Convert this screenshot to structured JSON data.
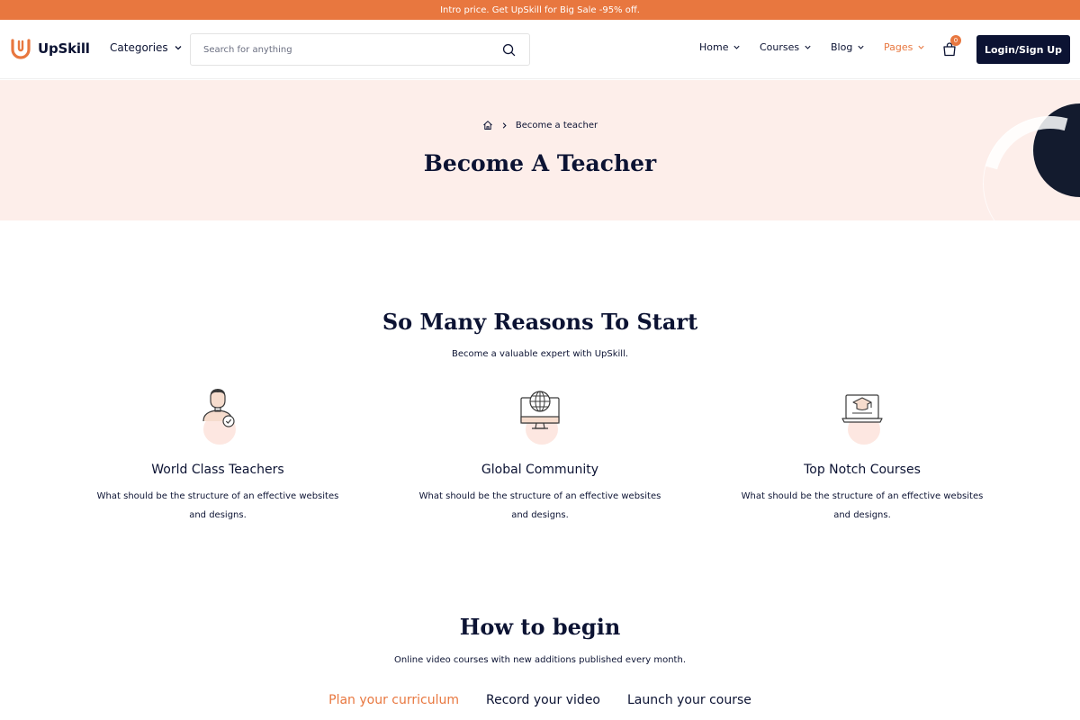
{
  "promo": {
    "text": "Intro price. Get UpSkill for Big Sale -95% off."
  },
  "header": {
    "logo_text": "UpSkill",
    "categories_label": "Categories",
    "search_placeholder": "Search for anything",
    "nav": [
      {
        "label": "Home",
        "active": false
      },
      {
        "label": "Courses",
        "active": false
      },
      {
        "label": "Blog",
        "active": false
      },
      {
        "label": "Pages",
        "active": true
      }
    ],
    "cart_count": "0",
    "login_label": "Login/Sign Up"
  },
  "colors": {
    "accent": "#e8773f",
    "dark": "#0c1333",
    "hero_bg": "#fdeeea"
  },
  "hero": {
    "breadcrumb_current": "Become a teacher",
    "title": "Become A Teacher"
  },
  "reasons": {
    "title": "So Many Reasons To Start",
    "subtitle": "Become a valuable expert with UpSkill.",
    "features": [
      {
        "icon": "teacher-icon",
        "title": "World Class Teachers",
        "desc_line1": "What should be the structure of an effective websites",
        "desc_line2": "and designs."
      },
      {
        "icon": "globe-monitor-icon",
        "title": "Global Community",
        "desc_line1": "What should be the structure of an effective websites",
        "desc_line2": "and designs."
      },
      {
        "icon": "laptop-graduation-icon",
        "title": "Top Notch Courses",
        "desc_line1": "What should be the structure of an effective websites",
        "desc_line2": "and designs."
      }
    ]
  },
  "how_to_begin": {
    "title": "How to begin",
    "subtitle": "Online video courses with new additions published every month.",
    "tabs": [
      {
        "label": "Plan your curriculum",
        "active": true
      },
      {
        "label": "Record your video",
        "active": false
      },
      {
        "label": "Launch your course",
        "active": false
      }
    ]
  }
}
